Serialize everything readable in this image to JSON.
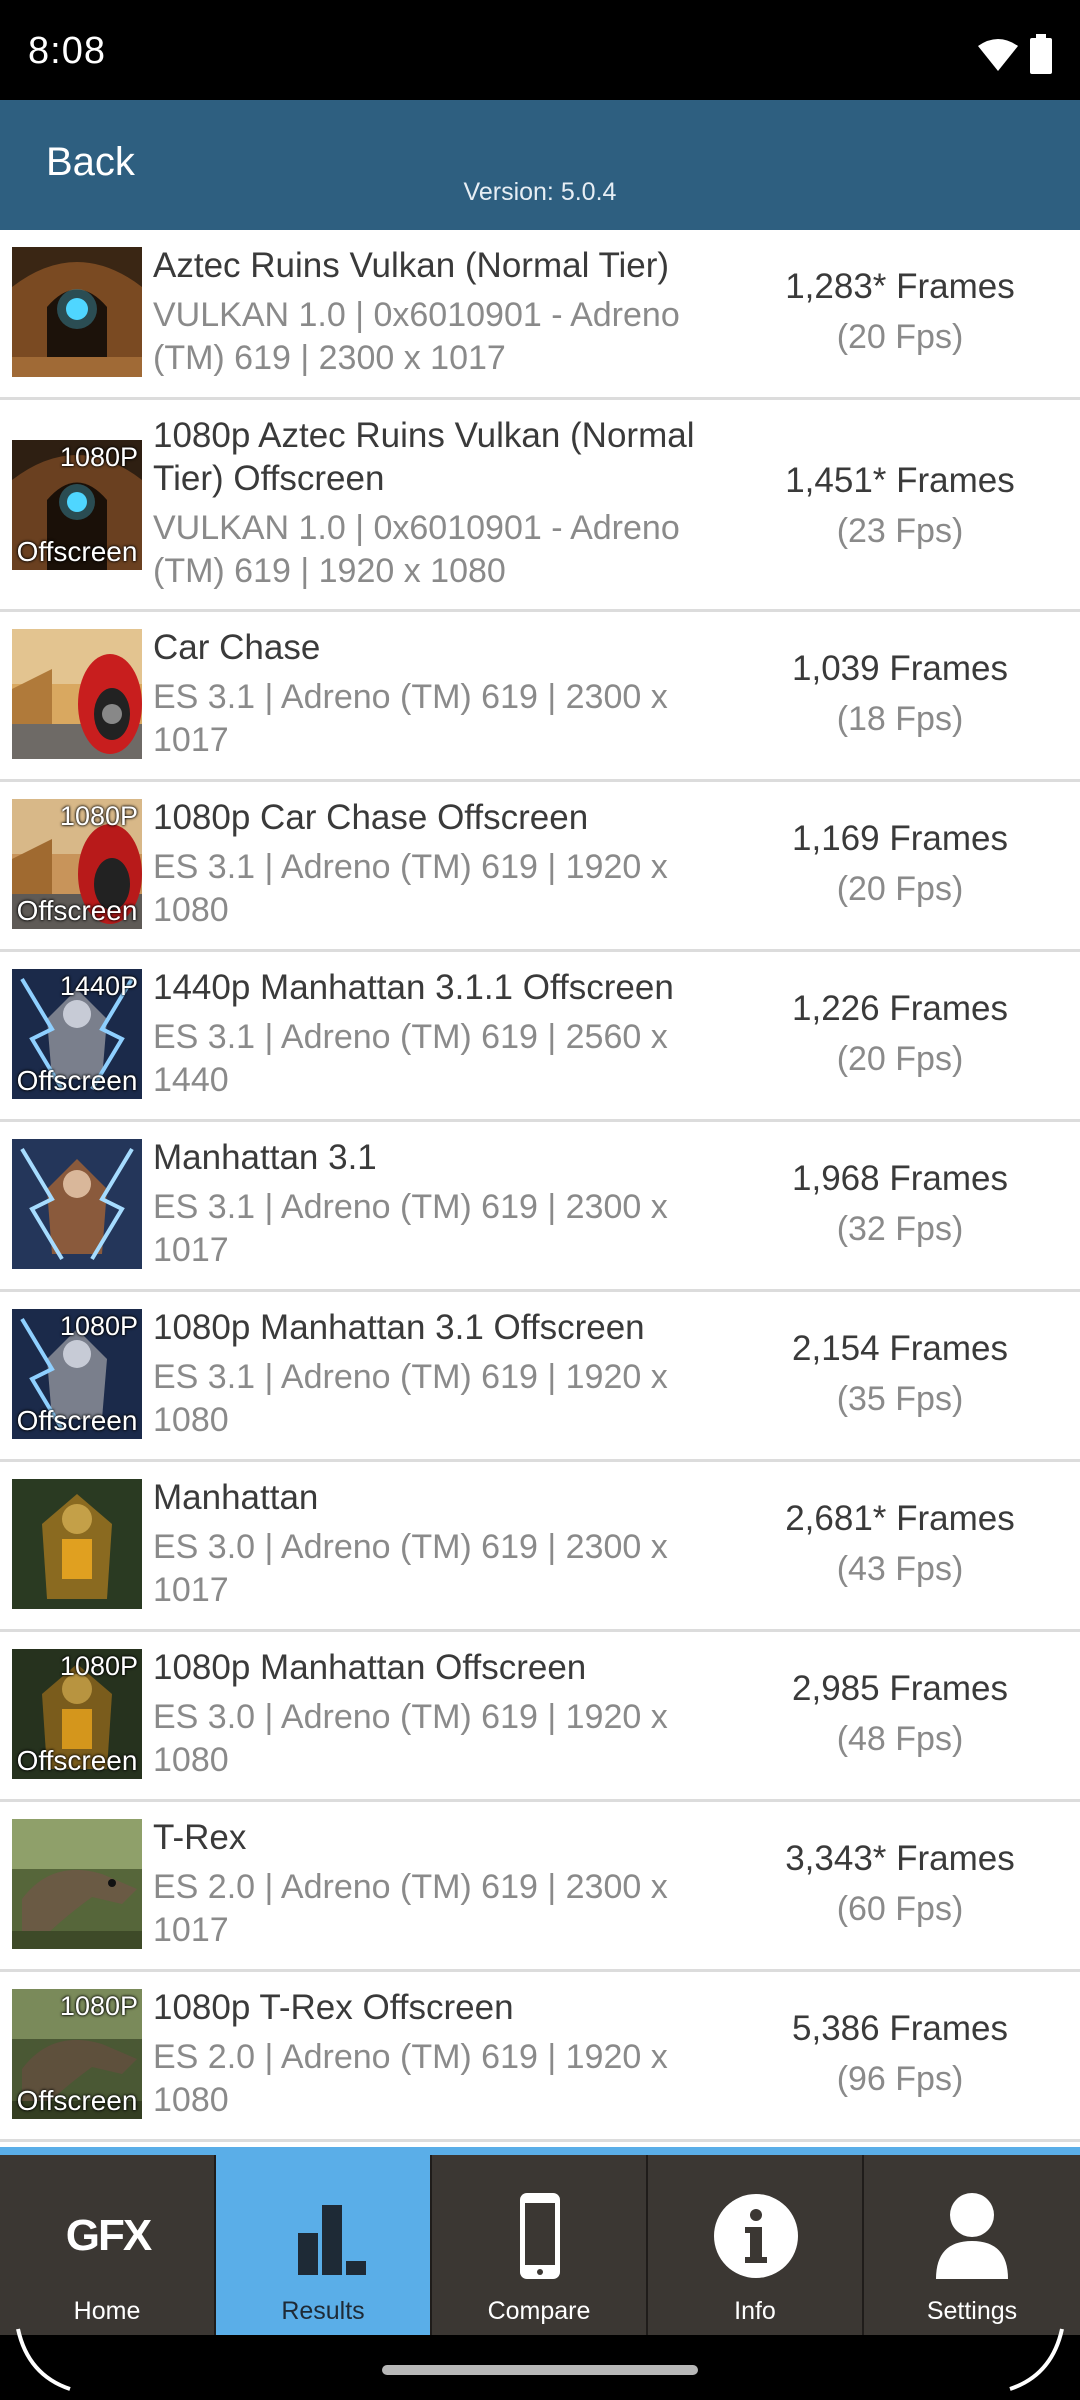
{
  "status_bar": {
    "time": "8:08",
    "wifi_icon": "wifi-icon",
    "battery_icon": "battery-icon"
  },
  "header": {
    "back_label": "Back",
    "version": "Version: 5.0.4",
    "background": "#2e5f80"
  },
  "results": [
    {
      "title": "Aztec Ruins Vulkan (Normal Tier)",
      "detail": "VULKAN 1.0 | 0x6010901 - Adreno (TM) 619 | 2300 x 1017",
      "frames": "1,283* Frames",
      "fps": "(20 Fps)",
      "res_overlay": "",
      "offscreen_overlay": ""
    },
    {
      "title": "1080p Aztec Ruins Vulkan (Normal Tier) Offscreen",
      "detail": "VULKAN 1.0 | 0x6010901 - Adreno (TM) 619 | 1920 x 1080",
      "frames": "1,451* Frames",
      "fps": "(23 Fps)",
      "res_overlay": "1080P",
      "offscreen_overlay": "Offscreen"
    },
    {
      "title": "Car Chase",
      "detail": "ES 3.1 | Adreno (TM) 619 | 2300 x 1017",
      "frames": "1,039 Frames",
      "fps": "(18 Fps)",
      "res_overlay": "",
      "offscreen_overlay": ""
    },
    {
      "title": "1080p Car Chase Offscreen",
      "detail": "ES 3.1 | Adreno (TM) 619 | 1920 x 1080",
      "frames": "1,169 Frames",
      "fps": "(20 Fps)",
      "res_overlay": "1080P",
      "offscreen_overlay": "Offscreen"
    },
    {
      "title": "1440p Manhattan 3.1.1 Offscreen",
      "detail": "ES 3.1 | Adreno (TM) 619 | 2560 x 1440",
      "frames": "1,226 Frames",
      "fps": "(20 Fps)",
      "res_overlay": "1440P",
      "offscreen_overlay": "Offscreen"
    },
    {
      "title": "Manhattan 3.1",
      "detail": "ES 3.1 | Adreno (TM) 619 | 2300 x 1017",
      "frames": "1,968 Frames",
      "fps": "(32 Fps)",
      "res_overlay": "",
      "offscreen_overlay": ""
    },
    {
      "title": "1080p Manhattan 3.1 Offscreen",
      "detail": "ES 3.1 | Adreno (TM) 619 | 1920 x 1080",
      "frames": "2,154 Frames",
      "fps": "(35 Fps)",
      "res_overlay": "1080P",
      "offscreen_overlay": "Offscreen"
    },
    {
      "title": "Manhattan",
      "detail": "ES 3.0 | Adreno (TM) 619 | 2300 x 1017",
      "frames": "2,681* Frames",
      "fps": "(43 Fps)",
      "res_overlay": "",
      "offscreen_overlay": ""
    },
    {
      "title": "1080p Manhattan Offscreen",
      "detail": "ES 3.0 | Adreno (TM) 619 | 1920 x 1080",
      "frames": "2,985 Frames",
      "fps": "(48 Fps)",
      "res_overlay": "1080P",
      "offscreen_overlay": "Offscreen"
    },
    {
      "title": "T-Rex",
      "detail": "ES 2.0 | Adreno (TM) 619 | 2300 x 1017",
      "frames": "3,343* Frames",
      "fps": "(60 Fps)",
      "res_overlay": "",
      "offscreen_overlay": ""
    },
    {
      "title": "1080p T-Rex Offscreen",
      "detail": "ES 2.0 | Adreno (TM) 619 | 1920 x 1080",
      "frames": "5,386 Frames",
      "fps": "(96 Fps)",
      "res_overlay": "1080P",
      "offscreen_overlay": "Offscreen"
    }
  ],
  "bottom_nav": {
    "active": "Results",
    "active_color": "#5aaee8",
    "items": [
      {
        "label": "Home",
        "icon": "gfx-logo-icon",
        "icon_text": "GFX"
      },
      {
        "label": "Results",
        "icon": "bar-chart-icon"
      },
      {
        "label": "Compare",
        "icon": "phone-icon"
      },
      {
        "label": "Info",
        "icon": "info-icon"
      },
      {
        "label": "Settings",
        "icon": "person-icon"
      }
    ]
  }
}
